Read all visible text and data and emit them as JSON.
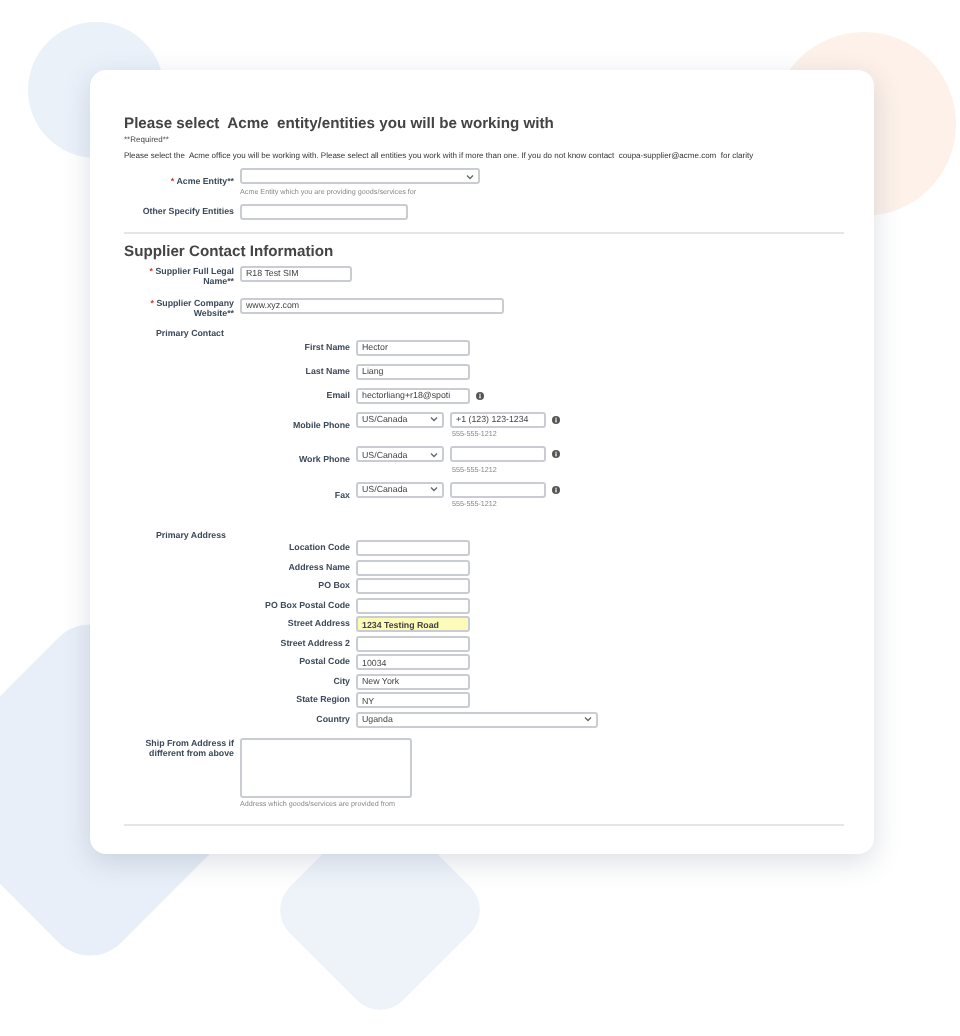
{
  "intro": {
    "title": "Please select  Acme  entity/entities you will be working with",
    "required_note": "**Required**",
    "description": "Please select the  Acme office you will be working with. Please select all entities you work with if more than one. If you do not know contact  coupa-supplier@acme.com  for clarity"
  },
  "entity_fields": [
    {
      "kind": "select",
      "label": "Acme Entity**",
      "required_mark": "*",
      "hint": "Acme Entity which you are providing goods/services for"
    },
    {
      "kind": "text",
      "label": "Other Specify Entities"
    }
  ],
  "contact": {
    "heading": "Supplier Contact Information",
    "fields": [
      {
        "kind": "text",
        "label": "Supplier Full Legal Name**",
        "required_mark": "*",
        "value": "R18 Test SIM"
      },
      {
        "kind": "wide-text",
        "label": "Supplier Company Website**",
        "required_mark": "*",
        "value": "www.xyz.com"
      }
    ]
  },
  "groups": [
    {
      "label": "Primary Contact",
      "fields": [
        {
          "kind": "text",
          "label": "First Name",
          "value": "Hector",
          "info": false
        },
        {
          "kind": "text",
          "label": "Last Name",
          "value": "Liang",
          "info": false
        },
        {
          "kind": "text",
          "label": "Email",
          "value": "hectorliang+r18@spoti",
          "info": true
        },
        {
          "kind": "phone",
          "label": "Mobile Phone",
          "country": "US/Canada",
          "value": "+1 (123) 123-1234",
          "hint": "555-555-1212",
          "info": true
        },
        {
          "kind": "phone",
          "label": "Work Phone",
          "country": "US/Canada",
          "hint": "555-555-1212",
          "info": true
        },
        {
          "kind": "phone",
          "label": "Fax",
          "country": "US/Canada",
          "hint": "555-555-1212",
          "info": true
        }
      ]
    },
    {
      "label": "Primary Address",
      "fields": [
        {
          "kind": "text",
          "label": "Location Code",
          "highlighted": false
        },
        {
          "kind": "text",
          "label": "Address Name",
          "highlighted": false
        },
        {
          "kind": "text",
          "label": "PO Box",
          "highlighted": false
        },
        {
          "kind": "text",
          "label": "PO Box Postal Code",
          "highlighted": false
        },
        {
          "kind": "text",
          "label": "Street Address",
          "value": "1234 Testing Road",
          "highlighted": true
        },
        {
          "kind": "text",
          "label": "Street Address 2",
          "highlighted": false
        },
        {
          "kind": "text",
          "label": "Postal Code",
          "value": "10034",
          "highlighted": false
        },
        {
          "kind": "text",
          "label": "City",
          "value": "New York",
          "highlighted": false
        },
        {
          "kind": "text",
          "label": "State Region",
          "value": "NY",
          "highlighted": false
        },
        {
          "kind": "select",
          "label": "Country",
          "value": "Uganda",
          "highlighted": false
        }
      ]
    }
  ],
  "ship_from": {
    "label": "Ship From Address if different from above",
    "hint": "Address which goods/services are provided from"
  }
}
